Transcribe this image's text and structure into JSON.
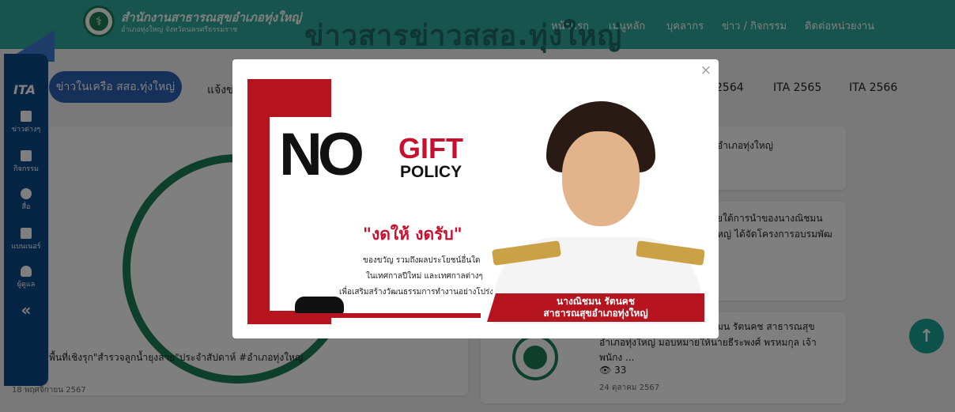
{
  "header": {
    "site_title": "สำนักงานสาธารณสุขอำเภอทุ่งใหญ่",
    "site_subtitle": "อำเภอทุ่งใหญ่ จังหวัดนครศรีธรรมราช",
    "headline": "ข่าวสาร",
    "headline_sub": "ข่าวสสอ.ทุ่งใหญ่",
    "nav": [
      "หน้าแรก",
      "เมนูหลัก",
      "บุคลากร",
      "ข่าว / กิจกรรม",
      "ติดต่อหน่วยงาน"
    ]
  },
  "sidebar": {
    "logo": "ITA",
    "items": [
      {
        "label": "ข่าวต่างๆ",
        "icon": "newspaper-icon"
      },
      {
        "label": "กิจกรรม",
        "icon": "calendar-icon"
      },
      {
        "label": "สื่อ",
        "icon": "play-icon"
      },
      {
        "label": "แบนเนอร์",
        "icon": "flag-icon"
      },
      {
        "label": "ผู้ดูแล",
        "icon": "user-icon"
      }
    ],
    "collapse": "«"
  },
  "tabs": {
    "active": "ข่าวในเครือ สสอ.ทุ่งใหญ่",
    "second": "แจ้งข่",
    "ita": [
      "2564",
      "ITA 2565",
      "ITA 2566"
    ]
  },
  "background_cards": {
    "left_caption": "พื้นที่เชิงรุก\"สำรวจลูกน้ำยุงลาย\"ประจำสัปดาห์ #อำเภอทุ่งใหญ่",
    "left_date": "18 พฤศจิกายน 2567",
    "right_card1": "อำเภอทุ่งใหญ่",
    "right_card2_line1": "ยใต้การนำของนางณิชมน",
    "right_card2_line2": "หญ่ ได้จัดโครงการอบรมพัฒ",
    "right_card3_line1": "มน รัตนคช สาธารณสุข",
    "right_card3_line2": "อำเภอทุ่งใหญ่ มอบหมายให้นายธีระพงศ์ พรหมกุล เจ้า",
    "right_card3_line3": "พนักง ...",
    "views": "33",
    "date": "24 ตุลาคม 2567"
  },
  "modal": {
    "close": "×",
    "poster": {
      "no": "NO",
      "gift": "GIFT",
      "policy": "POLICY",
      "slogan": "\"งดให้ งดรับ\"",
      "desc_lines": [
        "ของขวัญ รวมถึงผลประโยชน์อื่นใด",
        "ในเทศกาลปีใหม่ และเทศกาลต่างๆ",
        "เพื่อเสริมสร้างวัฒนธรรมการทำงานอย่างโปร่งใส"
      ],
      "name": "นางณิชมน รัตนคช",
      "position": "สาธารณสุขอำเภอทุ่งใหญ่"
    }
  },
  "scroll_top": "↑"
}
